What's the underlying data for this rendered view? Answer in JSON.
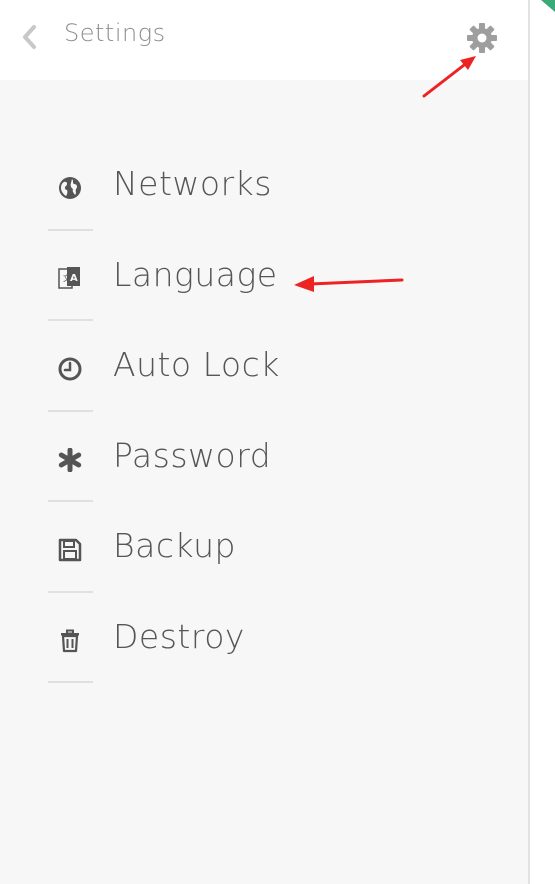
{
  "header": {
    "title": "Settings",
    "back_icon": "chevron-left-icon",
    "settings_icon": "gear-icon"
  },
  "menu": {
    "items": [
      {
        "label": "Networks",
        "icon": "globe-icon"
      },
      {
        "label": "Language",
        "icon": "translate-icon"
      },
      {
        "label": "Auto Lock",
        "icon": "clock-icon"
      },
      {
        "label": "Password",
        "icon": "asterisk-icon"
      },
      {
        "label": "Backup",
        "icon": "floppy-disk-icon"
      },
      {
        "label": "Destroy",
        "icon": "trash-icon"
      }
    ]
  },
  "colors": {
    "panel_bg": "#f7f7f7",
    "header_bg": "#ffffff",
    "text": "#555555",
    "title": "#8c8c8c",
    "icon": "#555555",
    "accent_green": "#3aaa78",
    "annotation_red": "#ee2222"
  }
}
